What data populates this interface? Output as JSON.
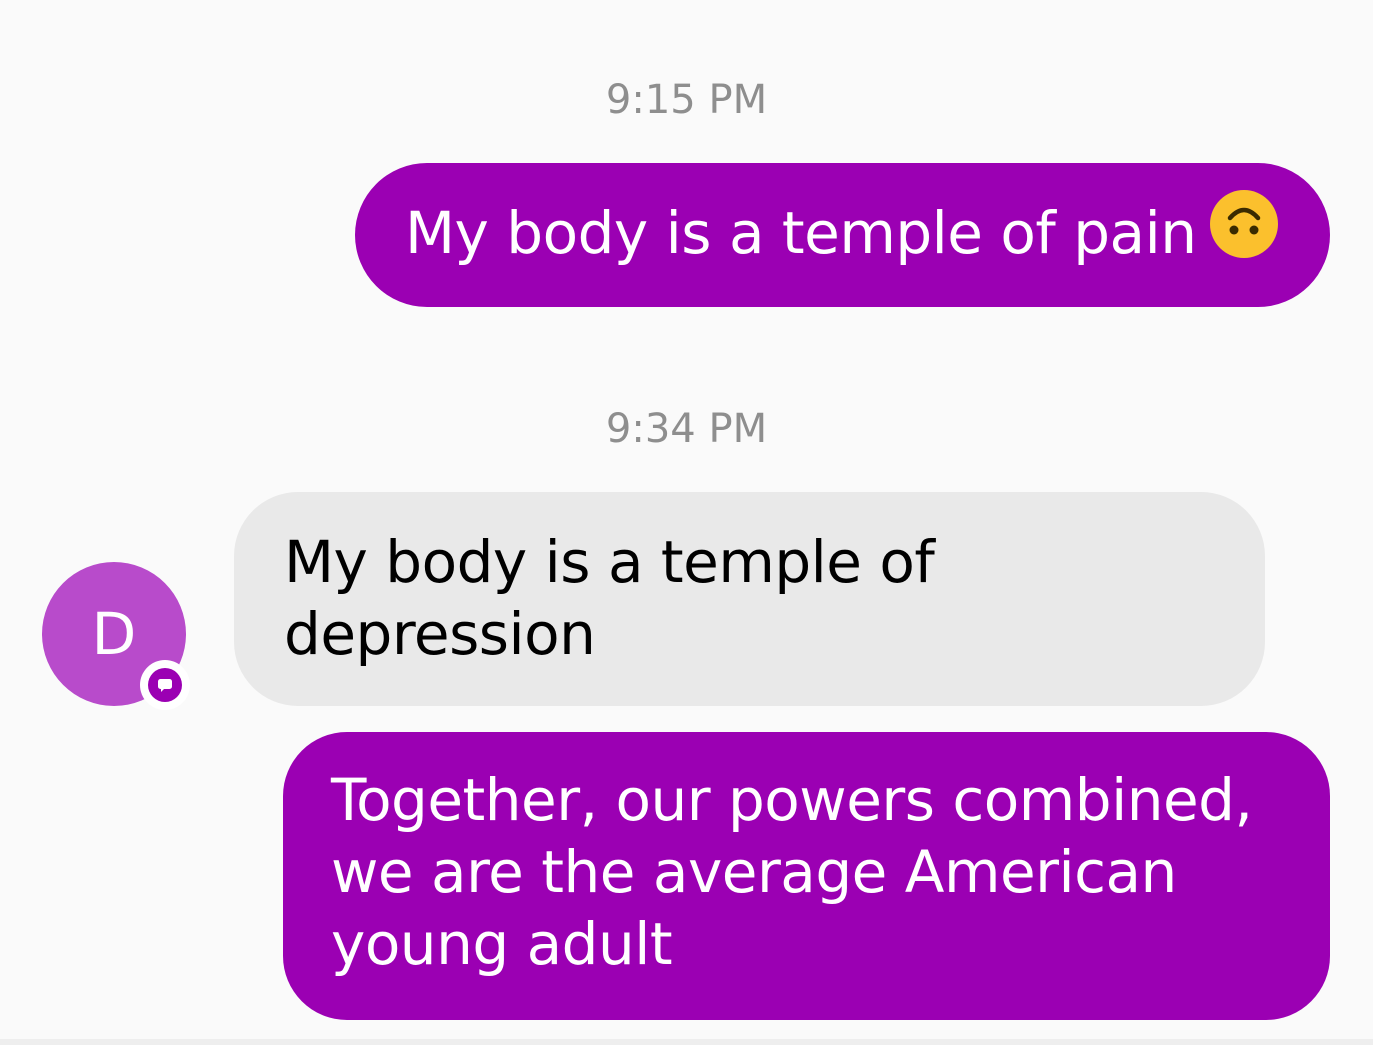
{
  "thread": {
    "groups": [
      {
        "timestamp": "9:15 PM",
        "messages": [
          {
            "direction": "outgoing",
            "text": "My body is a temple of pain",
            "emoji": "upside-down-face-icon"
          }
        ]
      },
      {
        "timestamp": "9:34 PM",
        "messages": [
          {
            "direction": "incoming",
            "sender_initial": "D",
            "lines": [
              "My body is a temple of",
              "depression"
            ]
          },
          {
            "direction": "outgoing",
            "lines": [
              "Together, our powers combined,",
              "we are the average American",
              "young adult"
            ]
          }
        ]
      }
    ]
  },
  "colors": {
    "outgoing_bubble": "#9b00b3",
    "incoming_bubble": "#e9e9e9",
    "avatar": "#b84bcb",
    "timestamp": "#8e8e8e",
    "background": "#fafafa"
  },
  "icons": {
    "avatar_badge": "chat-bubble-icon",
    "emoji": "upside-down-face-icon"
  }
}
